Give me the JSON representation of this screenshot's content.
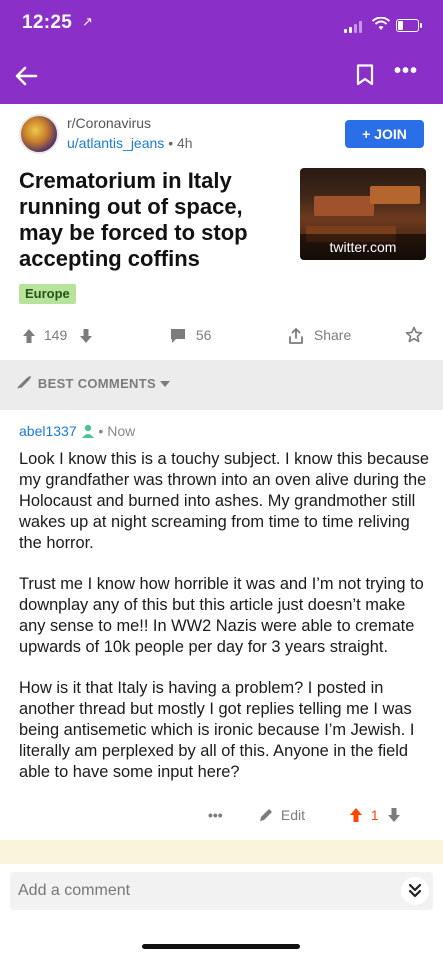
{
  "status": {
    "time": "12:25",
    "location_indicator": "↗"
  },
  "colors": {
    "header": "#8b2fc9",
    "join": "#2a6ee8",
    "link": "#1a7bd6",
    "flair_bg": "#b7e39a",
    "upvote": "#ff4500"
  },
  "nav": {
    "back_icon": "arrow-left-icon",
    "bookmark_icon": "bookmark-icon",
    "more_label": "•••"
  },
  "post": {
    "subreddit": "r/Coronavirus",
    "author": "u/atlantis_jeans",
    "separator": "•",
    "age": "4h",
    "join_label": "JOIN",
    "title": "Crematorium in Italy running out of space, may be forced to stop accepting coffins",
    "thumbnail_label": "twitter.com",
    "flair": "Europe",
    "upvotes": "149",
    "comments": "56",
    "share_label": "Share"
  },
  "sort": {
    "label": "BEST COMMENTS"
  },
  "comment": {
    "author": "abel1337",
    "separator": "•",
    "age": "Now",
    "paragraphs": [
      "Look I know this is a touchy subject. I know this because my grandfather was thrown into an oven alive during the Holocaust and burned into ashes. My grandmother still wakes up at night screaming from time to time reliving the horror.",
      "Trust me I know how horrible it was and I’m not trying to downplay any of this but this article just doesn’t make any sense to me!! In WW2 Nazis were able to cremate upwards of 10k people per day for 3 years straight.",
      "How is it that Italy is having a problem? I posted in another thread but mostly I got replies telling me I was being antisemetic which is ironic because I’m Jewish. I literally am perplexed by all of this. Anyone in the field able to have some input here?"
    ],
    "more_label": "•••",
    "edit_label": "Edit",
    "score": "1"
  },
  "composer": {
    "placeholder": "Add a comment"
  }
}
